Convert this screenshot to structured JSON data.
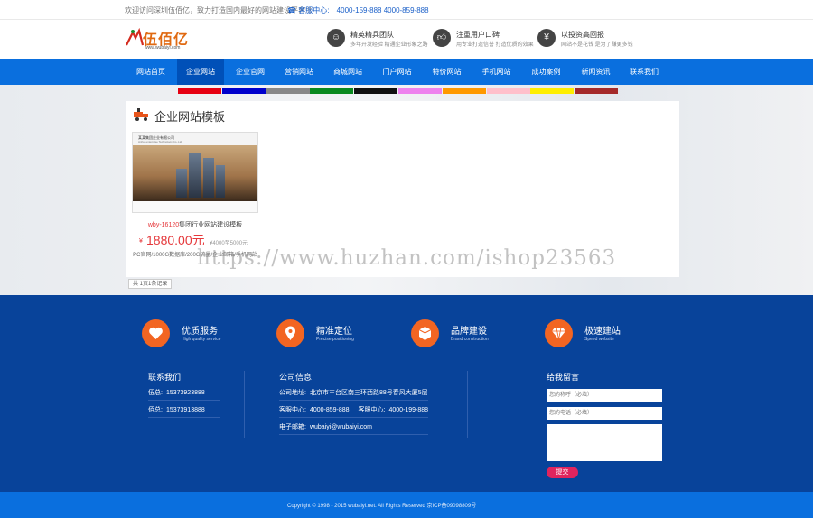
{
  "topbar": {
    "welcome": "欢迎访问深圳伍佰亿，致力打造国内最好的网站建设平台!!!",
    "hotline_label": "客服中心:",
    "hotline": "4000-159-888 4000-859-888"
  },
  "header": {
    "logo_name": "伍佰亿",
    "logo_url": "www.wubaiyi.com",
    "features": [
      {
        "title": "精英精兵团队",
        "desc": "多年开发经验 精通企业形象之路",
        "icon": "user-icon"
      },
      {
        "title": "注重用户口碑",
        "desc": "用专业打造信誉 打造优质的效果",
        "icon": "thumbs-up-icon"
      },
      {
        "title": "以投资高回报",
        "desc": "网站不是花钱 是为了赚更多钱",
        "icon": "money-icon"
      }
    ]
  },
  "nav": {
    "items": [
      "网站首页",
      "企业网站",
      "企业官网",
      "营销网站",
      "商城网站",
      "门户网站",
      "特价网站",
      "手机网站",
      "成功案例",
      "新闻资讯",
      "联系我们"
    ],
    "active_index": 1
  },
  "colorbar": {
    "colors": [
      "#e60012",
      "#0000cc",
      "#888888",
      "#0a8a1f",
      "#111111",
      "#ee82ee",
      "#ff9900",
      "#ffc0cb",
      "#ffee00",
      "#a52a2a"
    ]
  },
  "section": {
    "title": "企业网站模板"
  },
  "product": {
    "thumb_header": "某某集团企业有限公司",
    "thumb_header_en": "Anhui enterprise Technology Co.,Ltd.",
    "code": "wby-16120",
    "name": "集团行业网站建设模板",
    "price_symbol": "¥",
    "price": "1880.00元",
    "old_price": "¥4000至5000元",
    "desc": "PC官网/1000G数据库/200G流量/企业邮箱/手机网站"
  },
  "pager": {
    "text": "共 1页1条记录"
  },
  "watermark": {
    "text": "https://www.huzhan.com/ishop23563"
  },
  "footer": {
    "services": [
      {
        "name": "优质服务",
        "en": "High quality service",
        "icon": "heart-icon"
      },
      {
        "name": "精准定位",
        "en": "Precise positioning",
        "icon": "location-pin-icon"
      },
      {
        "name": "品牌建设",
        "en": "Brand construction",
        "icon": "cube-icon"
      },
      {
        "name": "极速建站",
        "en": "Speed website",
        "icon": "diamond-icon"
      }
    ],
    "contact": {
      "title": "联系我们",
      "lines": [
        {
          "label": "伍总:",
          "value": "15373923888"
        },
        {
          "label": "佰总:",
          "value": "15373913888"
        }
      ]
    },
    "company": {
      "title": "公司信息",
      "address_label": "公司地址:",
      "address": "北京市丰台区南三环西路88号春风大厦5层",
      "phone_label1": "客服中心:",
      "phone1": "4000-859-888",
      "phone_label2": "客服中心:",
      "phone2": "4000-199-888",
      "email_label": "电子邮箱:",
      "email": "wubaiyi@wubaiyi.com"
    },
    "message": {
      "title": "给我留言",
      "name_placeholder": "您的称呼（必填）",
      "phone_placeholder": "您的电话（必填）",
      "content_placeholder": "",
      "submit": "提交"
    }
  },
  "copyright": {
    "text": "Copyright © 1998 - 2015 wubaiyi.net. All Rights Reserved    京ICP备09098809号"
  }
}
